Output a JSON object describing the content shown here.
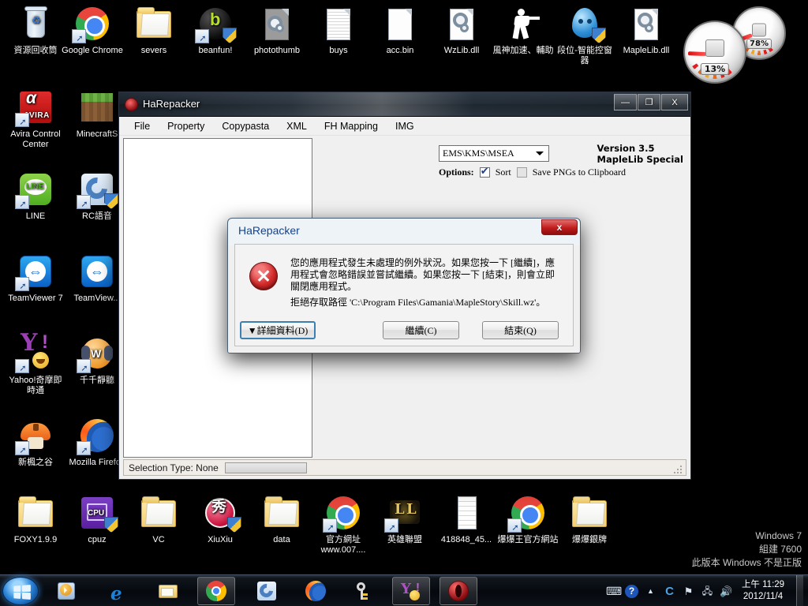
{
  "desktop": {
    "icons_top": [
      {
        "label": "資源回收筒",
        "icon": "recycle-bin-icon",
        "kind": "bin"
      },
      {
        "label": "Google Chrome",
        "icon": "google-chrome-icon",
        "kind": "chrome",
        "shortcut": true
      },
      {
        "label": "severs",
        "icon": "folder-icon",
        "kind": "folder"
      },
      {
        "label": "beanfun!",
        "icon": "beanfun-icon",
        "kind": "beanfun",
        "shortcut": true,
        "shield": true
      },
      {
        "label": "photothumb",
        "icon": "dll-file-icon",
        "kind": "graydoc"
      },
      {
        "label": "buys",
        "icon": "text-file-icon",
        "kind": "lineddoc"
      },
      {
        "label": "acc.bin",
        "icon": "bin-file-icon",
        "kind": "plaindoc"
      },
      {
        "label": "WzLib.dll",
        "icon": "dll-file-icon",
        "kind": "geardoc"
      },
      {
        "label": "風神加速、輔助",
        "icon": "counter-strike-icon",
        "kind": "cs"
      },
      {
        "label": "段位-智能控窗器",
        "icon": "water-drop-icon",
        "kind": "drop",
        "shield": true
      },
      {
        "label": "MapleLib.dll",
        "icon": "dll-file-icon",
        "kind": "geardoc"
      }
    ],
    "icons_left": [
      {
        "label": "Avira Control Center",
        "icon": "avira-icon",
        "kind": "avira",
        "shortcut": true
      },
      {
        "label": "MinecraftS",
        "icon": "minecraft-icon",
        "kind": "minecraft"
      },
      {
        "label": "LINE",
        "icon": "line-icon",
        "kind": "line",
        "shortcut": true
      },
      {
        "label": "RC語音",
        "icon": "rc-voice-icon",
        "kind": "rc",
        "shortcut": true,
        "shield": true
      },
      {
        "label": "TeamViewer 7",
        "icon": "teamviewer-icon",
        "kind": "tv",
        "shortcut": true
      },
      {
        "label": "TeamView...",
        "icon": "teamviewer-icon",
        "kind": "tv"
      },
      {
        "label": "Yahoo!奇摩即時通",
        "icon": "yahoo-messenger-icon",
        "kind": "yahoo",
        "shortcut": true
      },
      {
        "label": "千千靜聽",
        "icon": "ttplayer-icon",
        "kind": "ttplayer",
        "shortcut": true
      },
      {
        "label": "新楓之谷",
        "icon": "maplestory-icon",
        "kind": "maple",
        "shortcut": true
      },
      {
        "label": "Mozilla Firefox",
        "icon": "firefox-icon",
        "kind": "firefox",
        "shortcut": true
      }
    ],
    "icons_bottom": [
      {
        "label": "FOXY1.9.9",
        "icon": "folder-icon",
        "kind": "folder"
      },
      {
        "label": "cpuz",
        "icon": "cpuz-icon",
        "kind": "cpuz",
        "shield": true
      },
      {
        "label": "VC",
        "icon": "folder-icon",
        "kind": "folder"
      },
      {
        "label": "XiuXiu",
        "icon": "xiuxiu-icon",
        "kind": "xiuxiu",
        "shield": true
      },
      {
        "label": "data",
        "icon": "folder-icon",
        "kind": "folder"
      },
      {
        "label": "官方網址 www.007....",
        "icon": "google-chrome-icon",
        "kind": "chrome",
        "shortcut": true
      },
      {
        "label": "英雄聯盟",
        "icon": "league-of-legends-icon",
        "kind": "lol",
        "shortcut": true
      },
      {
        "label": "418848_45...",
        "icon": "image-file-icon",
        "kind": "thumbs"
      },
      {
        "label": "爆爆王官方網站",
        "icon": "google-chrome-icon",
        "kind": "chrome",
        "shortcut": true
      },
      {
        "label": "爆爆銀牌",
        "icon": "folder-icon",
        "kind": "folder"
      }
    ]
  },
  "gadget": {
    "cpu_label": "13%",
    "ram_label": "78%",
    "cpu_name": "cpu-meter",
    "ram_name": "memory-meter"
  },
  "watermark": {
    "line1": "Windows 7",
    "line2": "組建 7600",
    "line3": "此版本 Windows 不是正版"
  },
  "harepacker": {
    "title": "HaRepacker",
    "minimize": "—",
    "maximize": "❐",
    "close": "X",
    "menu": [
      "File",
      "Property",
      "Copypasta",
      "XML",
      "FH Mapping",
      "IMG"
    ],
    "combo_value": "EMS\\KMS\\MSEA",
    "options_label": "Options:",
    "sort_label": "Sort",
    "sort_checked": true,
    "savepng_label": "Save PNGs to Clipboard",
    "savepng_checked": false,
    "version_line1": "Version 3.5",
    "version_line2": "MapleLib Special",
    "status": "Selection Type: None"
  },
  "dialog": {
    "title": "HaRepacker",
    "close": "x",
    "message": "您的應用程式發生未處理的例外狀況。如果您按一下 [繼續]，應用程式會忽略錯誤並嘗試繼續。如果您按一下 [結束]，則會立即關閉應用程式。",
    "detail": "拒絕存取路徑 'C:\\Program Files\\Gamania\\MapleStory\\Skill.wz'。",
    "btn_details": "▼詳細資料(D)",
    "btn_continue": "繼續(C)",
    "btn_quit": "結束(Q)"
  },
  "taskbar": {
    "start": "start-orb",
    "buttons": [
      {
        "name": "windows-media-player",
        "kind": "wmp"
      },
      {
        "name": "internet-explorer",
        "kind": "ie"
      },
      {
        "name": "windows-explorer",
        "kind": "explorer"
      },
      {
        "name": "google-chrome",
        "kind": "chrome",
        "active": true
      },
      {
        "name": "rc-voice",
        "kind": "rc"
      },
      {
        "name": "mozilla-firefox",
        "kind": "firefox"
      },
      {
        "name": "keys-utility",
        "kind": "keys"
      },
      {
        "name": "yahoo-messenger",
        "kind": "yahoo",
        "active": true
      },
      {
        "name": "harepacker",
        "kind": "avira",
        "active": true
      }
    ],
    "tray": [
      {
        "name": "keyboard-layout-icon",
        "glyph": "⌨"
      },
      {
        "name": "help-icon",
        "glyph": "?"
      },
      {
        "name": "show-hidden-icons-icon",
        "glyph": "▴"
      },
      {
        "name": "rc-voice-tray-icon",
        "glyph": "C"
      },
      {
        "name": "flag-action-center-icon",
        "glyph": "⚑"
      },
      {
        "name": "network-icon",
        "glyph": "🖧"
      },
      {
        "name": "volume-icon",
        "glyph": "🔊"
      }
    ],
    "clock_time": "上午 11:29",
    "clock_date": "2012/11/4"
  }
}
